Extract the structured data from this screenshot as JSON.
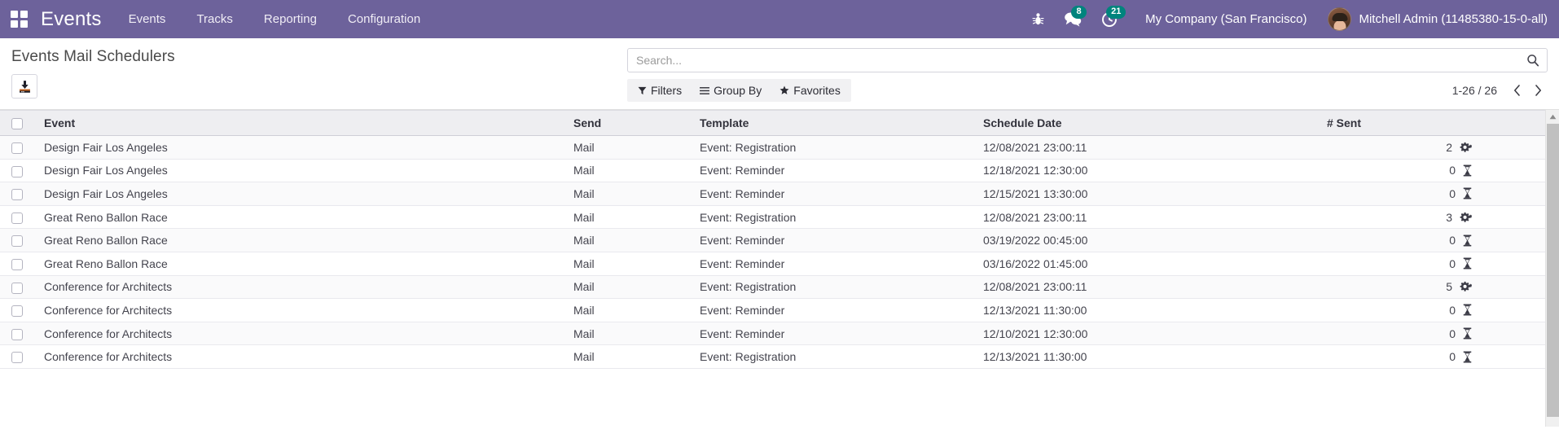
{
  "navbar": {
    "apps_icon": "apps-grid-icon",
    "brand": "Events",
    "menu": [
      {
        "label": "Events"
      },
      {
        "label": "Tracks"
      },
      {
        "label": "Reporting"
      },
      {
        "label": "Configuration"
      }
    ],
    "system_icons": [
      {
        "name": "bug-icon",
        "glyph": "bug",
        "badge": null
      },
      {
        "name": "messages-icon",
        "glyph": "comments",
        "badge": "8"
      },
      {
        "name": "activities-icon",
        "glyph": "clock",
        "badge": "21"
      }
    ],
    "company": "My Company (San Francisco)",
    "user": "Mitchell Admin (11485380-15-0-all)",
    "accent_color": "#6d629b",
    "badge_color": "#00847d"
  },
  "control_panel": {
    "title": "Events Mail Schedulers",
    "import_button": "import-icon",
    "search": {
      "placeholder": "Search...",
      "value": "",
      "icon": "search-icon"
    },
    "tools": [
      {
        "name": "filters-button",
        "label": "Filters",
        "icon": "funnel-icon"
      },
      {
        "name": "group-by-button",
        "label": "Group By",
        "icon": "bars-icon"
      },
      {
        "name": "favorites-button",
        "label": "Favorites",
        "icon": "star-icon"
      }
    ],
    "pager": {
      "range": "1-26 / 26",
      "prev_icon": "chevron-left-icon",
      "next_icon": "chevron-right-icon"
    }
  },
  "table": {
    "columns": [
      {
        "key": "event",
        "label": "Event"
      },
      {
        "key": "send",
        "label": "Send"
      },
      {
        "key": "template",
        "label": "Template"
      },
      {
        "key": "schedule_date",
        "label": "Schedule Date"
      },
      {
        "key": "sent",
        "label": "# Sent"
      }
    ],
    "rows": [
      {
        "event": "Design Fair Los Angeles",
        "send": "Mail",
        "template": "Event: Registration",
        "schedule_date": "12/08/2021 23:00:11",
        "sent": "2",
        "state_icon": "cogs-icon"
      },
      {
        "event": "Design Fair Los Angeles",
        "send": "Mail",
        "template": "Event: Reminder",
        "schedule_date": "12/18/2021 12:30:00",
        "sent": "0",
        "state_icon": "hourglass-icon"
      },
      {
        "event": "Design Fair Los Angeles",
        "send": "Mail",
        "template": "Event: Reminder",
        "schedule_date": "12/15/2021 13:30:00",
        "sent": "0",
        "state_icon": "hourglass-icon"
      },
      {
        "event": "Great Reno Ballon Race",
        "send": "Mail",
        "template": "Event: Registration",
        "schedule_date": "12/08/2021 23:00:11",
        "sent": "3",
        "state_icon": "cogs-icon"
      },
      {
        "event": "Great Reno Ballon Race",
        "send": "Mail",
        "template": "Event: Reminder",
        "schedule_date": "03/19/2022 00:45:00",
        "sent": "0",
        "state_icon": "hourglass-icon"
      },
      {
        "event": "Great Reno Ballon Race",
        "send": "Mail",
        "template": "Event: Reminder",
        "schedule_date": "03/16/2022 01:45:00",
        "sent": "0",
        "state_icon": "hourglass-icon"
      },
      {
        "event": "Conference for Architects",
        "send": "Mail",
        "template": "Event: Registration",
        "schedule_date": "12/08/2021 23:00:11",
        "sent": "5",
        "state_icon": "cogs-icon"
      },
      {
        "event": "Conference for Architects",
        "send": "Mail",
        "template": "Event: Reminder",
        "schedule_date": "12/13/2021 11:30:00",
        "sent": "0",
        "state_icon": "hourglass-icon"
      },
      {
        "event": "Conference for Architects",
        "send": "Mail",
        "template": "Event: Reminder",
        "schedule_date": "12/10/2021 12:30:00",
        "sent": "0",
        "state_icon": "hourglass-icon"
      },
      {
        "event": "Conference for Architects",
        "send": "Mail",
        "template": "Event: Registration",
        "schedule_date": "12/13/2021 11:30:00",
        "sent": "0",
        "state_icon": "hourglass-icon"
      }
    ]
  }
}
